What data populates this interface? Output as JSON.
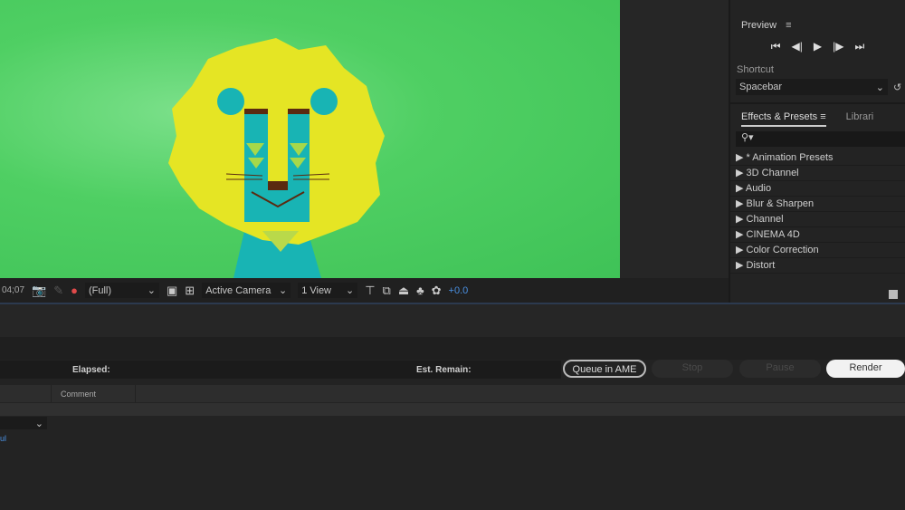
{
  "viewer": {
    "timecode": "04;07",
    "resolution": "(Full)",
    "camera": "Active Camera",
    "views": "1 View",
    "exposure": "+0.0"
  },
  "preview": {
    "title": "Preview",
    "shortcut_label": "Shortcut",
    "shortcut_value": "Spacebar"
  },
  "effects": {
    "tab_active": "Effects & Presets",
    "tab_other": "Librari",
    "search_placeholder": "",
    "items": [
      "* Animation Presets",
      "3D Channel",
      "Audio",
      "Blur & Sharpen",
      "Channel",
      "CINEMA 4D",
      "Color Correction",
      "Distort"
    ]
  },
  "render": {
    "elapsed_label": "Elapsed:",
    "remain_label": "Est. Remain:",
    "queue_ame": "Queue in AME",
    "stop": "Stop",
    "pause": "Pause",
    "render": "Render",
    "comment_header": "Comment",
    "link_fragment": "ul"
  },
  "colors": {
    "accent": "#4a90e2",
    "bg": "#232323",
    "viewer_green": "#4fcf63"
  }
}
